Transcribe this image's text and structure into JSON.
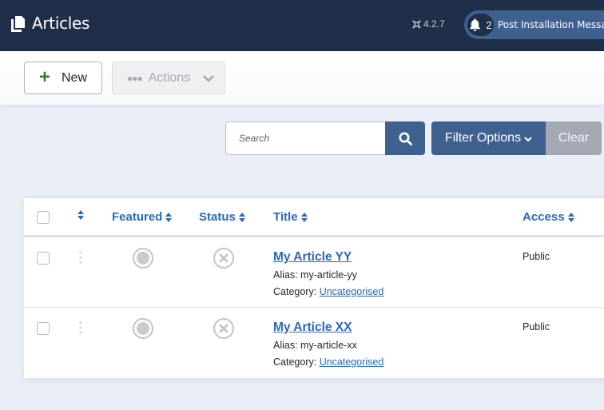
{
  "header": {
    "title": "Articles",
    "page_icon": "copy-icon",
    "version": "4.2.7",
    "version_icon": "joomla-icon",
    "notifications": {
      "icon": "bell-icon",
      "count": "2",
      "label": "Post Installation Messages"
    }
  },
  "toolbar": {
    "new_label": "New",
    "new_icon": "plus-icon",
    "actions_label": "Actions",
    "actions_icon": "ellipsis-icon"
  },
  "filters": {
    "search_placeholder": "Search",
    "search_value": "",
    "filter_options_label": "Filter Options",
    "clear_label": "Clear"
  },
  "table": {
    "columns": [
      "",
      "",
      "Featured",
      "Status",
      "Title",
      "Access"
    ],
    "rows": [
      {
        "title": "My Article YY",
        "alias_label": "Alias: my-article-yy",
        "category_prefix": "Category:",
        "category": "Uncategorised",
        "access": "Public",
        "featured": "unfeatured",
        "status": "unpublished"
      },
      {
        "title": "My Article XX",
        "alias_label": "Alias: my-article-xx",
        "category_prefix": "Category:",
        "category": "Uncategorised",
        "access": "Public",
        "featured": "unfeatured",
        "status": "unpublished"
      }
    ]
  },
  "colors": {
    "header_bg": "#1f2f49",
    "accent": "#3f6190",
    "link": "#2a69b8",
    "new_plus": "#3b7a3e"
  }
}
